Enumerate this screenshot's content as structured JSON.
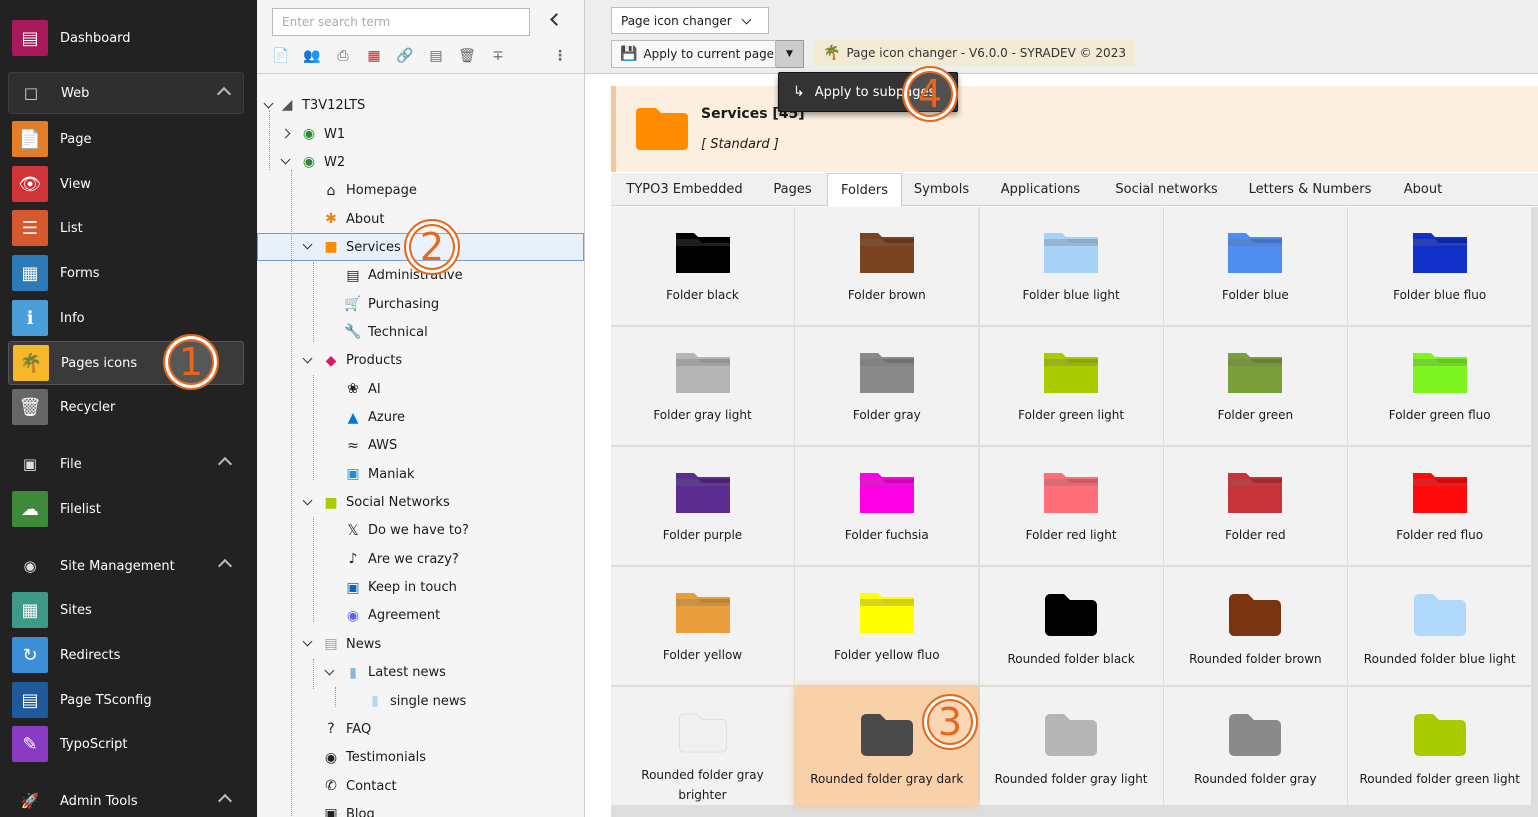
{
  "module_menu": {
    "items": [
      {
        "kind": "item",
        "label": "Dashboard",
        "icon": "dashboard-icon",
        "color": "#a7195a"
      },
      {
        "kind": "group",
        "label": "Web",
        "icon": "web-icon"
      },
      {
        "kind": "item",
        "label": "Page",
        "icon": "page-icon",
        "color": "#e37e27"
      },
      {
        "kind": "item",
        "label": "View",
        "icon": "view-icon",
        "color": "#d03438"
      },
      {
        "kind": "item",
        "label": "List",
        "icon": "list-icon",
        "color": "#d6582e"
      },
      {
        "kind": "item",
        "label": "Forms",
        "icon": "forms-icon",
        "color": "#2c7ab8"
      },
      {
        "kind": "item",
        "label": "Info",
        "icon": "info-icon",
        "color": "#4b9fd8"
      },
      {
        "kind": "item",
        "label": "Pages icons",
        "icon": "palm-icon",
        "color": "#f6b72b",
        "active": true
      },
      {
        "kind": "item",
        "label": "Recycler",
        "icon": "recycler-icon",
        "color": "#666666"
      },
      {
        "kind": "group",
        "label": "File",
        "icon": "file-icon"
      },
      {
        "kind": "item",
        "label": "Filelist",
        "icon": "filelist-icon",
        "color": "#3f8a3a"
      },
      {
        "kind": "group",
        "label": "Site Management",
        "icon": "site-management-icon"
      },
      {
        "kind": "item",
        "label": "Sites",
        "icon": "sites-icon",
        "color": "#3e9a87"
      },
      {
        "kind": "item",
        "label": "Redirects",
        "icon": "redirects-icon",
        "color": "#3c8fd6"
      },
      {
        "kind": "item",
        "label": "Page TSconfig",
        "icon": "tsconfig-icon",
        "color": "#1e5a9b"
      },
      {
        "kind": "item",
        "label": "TypoScript",
        "icon": "typoscript-icon",
        "color": "#8a3bc4"
      },
      {
        "kind": "group",
        "label": "Admin Tools",
        "icon": "admin-tools-icon"
      }
    ]
  },
  "tree": {
    "search_placeholder": "Enter search term",
    "root": "T3V12LTS",
    "nodes": [
      {
        "label": "W1",
        "icon": "globe-icon",
        "color": "#2c8a2c"
      },
      {
        "label": "W2",
        "icon": "globe-icon",
        "color": "#2c8a2c"
      },
      {
        "label": "Homepage",
        "icon": "home-icon",
        "color": "#222222"
      },
      {
        "label": "About",
        "icon": "asterisk-icon",
        "color": "#f0850f"
      },
      {
        "label": "Services",
        "icon": "folder-icon",
        "color": "#ff8c00"
      },
      {
        "label": "Administrative",
        "icon": "archive-icon",
        "color": "#222222"
      },
      {
        "label": "Purchasing",
        "icon": "cart-icon",
        "color": "#222222"
      },
      {
        "label": "Technical",
        "icon": "wrench-icon",
        "color": "#e8a020"
      },
      {
        "label": "Products",
        "icon": "cube-icon",
        "color": "#e0186c"
      },
      {
        "label": "AI",
        "icon": "openai-icon",
        "color": "#222222"
      },
      {
        "label": "Azure",
        "icon": "azure-icon",
        "color": "#0078d4"
      },
      {
        "label": "AWS",
        "icon": "aws-icon",
        "color": "#222222"
      },
      {
        "label": "Maniak",
        "icon": "maniak-icon",
        "color": "#1a8fe0"
      },
      {
        "label": "Social Networks",
        "icon": "folder-icon",
        "color": "#a8cc00"
      },
      {
        "label": "Do we have to?",
        "icon": "x-icon",
        "color": "#222222"
      },
      {
        "label": "Are we crazy?",
        "icon": "tiktok-icon",
        "color": "#222222"
      },
      {
        "label": "Keep in touch",
        "icon": "linkedin-icon",
        "color": "#0a66c2"
      },
      {
        "label": "Agreement",
        "icon": "discord-icon",
        "color": "#5865f2"
      },
      {
        "label": "News",
        "icon": "news-folder-icon",
        "color": "#8aa0b8"
      },
      {
        "label": "Latest news",
        "icon": "page-icon",
        "color": "#8ab8e0"
      },
      {
        "label": "single news",
        "icon": "page-icon",
        "color": "#b8d8f0"
      },
      {
        "label": "FAQ",
        "icon": "question-icon",
        "color": "#222222"
      },
      {
        "label": "Testimonials",
        "icon": "testimonials-icon",
        "color": "#222222"
      },
      {
        "label": "Contact",
        "icon": "phone-icon",
        "color": "#222222"
      },
      {
        "label": "Blog",
        "icon": "blog-icon",
        "color": "#222222"
      }
    ]
  },
  "header": {
    "module_select": "Page icon changer",
    "apply_button": "Apply to current page",
    "version": "Page icon changer - V6.0.0 - SYRADEV © 2023",
    "dropdown_item": "Apply to subpages"
  },
  "page_info": {
    "title": "Services [45]",
    "type": "[ Standard ]",
    "folder_color": "#ff8c00"
  },
  "tabs": [
    {
      "label": "TYPO3 Embedded"
    },
    {
      "label": "Pages"
    },
    {
      "label": "Folders",
      "active": true
    },
    {
      "label": "Symbols"
    },
    {
      "label": "Applications"
    },
    {
      "label": "Social networks"
    },
    {
      "label": "Letters & Numbers"
    },
    {
      "label": "About"
    }
  ],
  "icons": [
    {
      "label": "Folder black",
      "color": "#000000",
      "shape": "square"
    },
    {
      "label": "Folder brown",
      "color": "#7a4420",
      "shape": "square"
    },
    {
      "label": "Folder blue light",
      "color": "#a8d2f7",
      "shape": "square"
    },
    {
      "label": "Folder blue",
      "color": "#4d8ef0",
      "shape": "square"
    },
    {
      "label": "Folder blue fluo",
      "color": "#1030c8",
      "shape": "square"
    },
    {
      "label": "Folder gray light",
      "color": "#b5b5b5",
      "shape": "square"
    },
    {
      "label": "Folder gray",
      "color": "#8a8a8a",
      "shape": "square"
    },
    {
      "label": "Folder green light",
      "color": "#a8cc00",
      "shape": "square"
    },
    {
      "label": "Folder green",
      "color": "#7a9e3a",
      "shape": "square"
    },
    {
      "label": "Folder green fluo",
      "color": "#7cf521",
      "shape": "square"
    },
    {
      "label": "Folder purple",
      "color": "#5c2d91",
      "shape": "square"
    },
    {
      "label": "Folder fuchsia",
      "color": "#ff00e6",
      "shape": "square"
    },
    {
      "label": "Folder red light",
      "color": "#ff6f7a",
      "shape": "square"
    },
    {
      "label": "Folder red",
      "color": "#c8323a",
      "shape": "square"
    },
    {
      "label": "Folder red fluo",
      "color": "#ff0a0a",
      "shape": "square"
    },
    {
      "label": "Folder yellow",
      "color": "#e9a03c",
      "shape": "square"
    },
    {
      "label": "Folder yellow fluo",
      "color": "#ffff00",
      "shape": "square"
    },
    {
      "label": "Rounded folder black",
      "color": "#000000",
      "shape": "rounded"
    },
    {
      "label": "Rounded folder brown",
      "color": "#7a3410",
      "shape": "rounded"
    },
    {
      "label": "Rounded folder blue light",
      "color": "#b0d8fa",
      "shape": "rounded"
    },
    {
      "label": "Rounded folder gray brighter",
      "color": "#f0f0f0",
      "shape": "rounded"
    },
    {
      "label": "Rounded folder gray dark",
      "color": "#4a4a4a",
      "shape": "rounded",
      "selected": true
    },
    {
      "label": "Rounded folder gray light",
      "color": "#b5b5b5",
      "shape": "rounded"
    },
    {
      "label": "Rounded folder gray",
      "color": "#8a8a8a",
      "shape": "rounded"
    },
    {
      "label": "Rounded folder green light",
      "color": "#a8cc00",
      "shape": "rounded"
    }
  ],
  "steps": [
    "1",
    "2",
    "3",
    "4"
  ]
}
